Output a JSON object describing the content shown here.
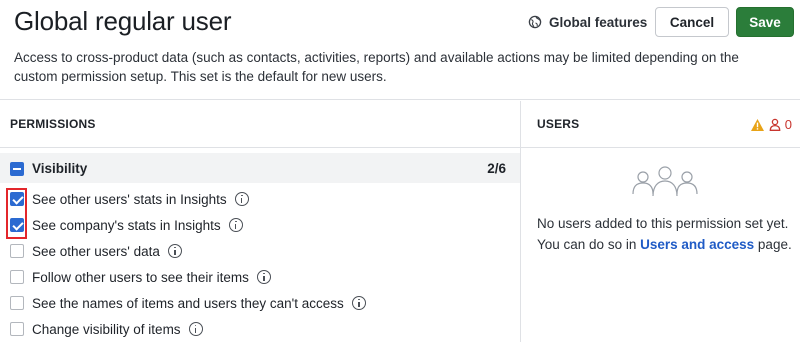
{
  "header": {
    "title": "Global regular user",
    "description": "Access to cross-product data (such as contacts, activities, reports) and available actions may be limited depending on the custom permission setup. This set is the default for new users.",
    "global_features_label": "Global features",
    "cancel_label": "Cancel",
    "save_label": "Save"
  },
  "permissions": {
    "heading": "PERMISSIONS",
    "group": {
      "label": "Visibility",
      "count": "2/6"
    },
    "items": [
      {
        "label": "See other users' stats in Insights",
        "checked": true
      },
      {
        "label": "See company's stats in Insights",
        "checked": true
      },
      {
        "label": "See other users' data",
        "checked": false
      },
      {
        "label": "Follow other users to see their items",
        "checked": false
      },
      {
        "label": "See the names of items and users they can't access",
        "checked": false
      },
      {
        "label": "Change visibility of items",
        "checked": false
      }
    ]
  },
  "users": {
    "heading": "USERS",
    "count": "0",
    "empty_line1": "No users added to this permission set yet.",
    "empty_line2_prefix": "You can do so in ",
    "empty_link": "Users and access",
    "empty_line2_suffix": " page."
  },
  "colors": {
    "save": "#2b7d3a",
    "checkbox": "#2b6ad1",
    "link": "#1f5bc6",
    "warning": "#e8a317",
    "alert": "#c8352e",
    "highlight": "#e3262b"
  }
}
